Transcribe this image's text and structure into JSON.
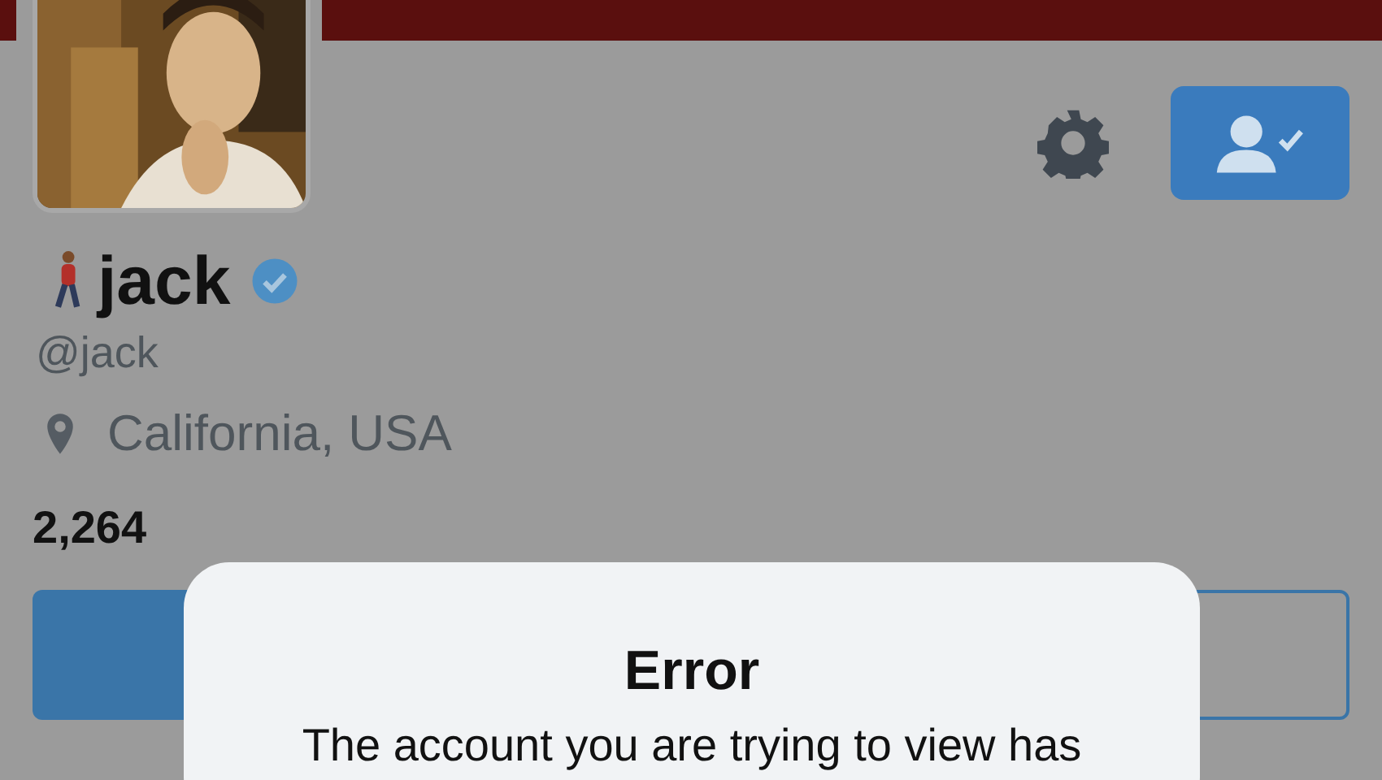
{
  "profile": {
    "name": "jack",
    "verified": true,
    "handle": "@jack",
    "location": "California, USA",
    "following_count": "2,264"
  },
  "dialog": {
    "title": "Error",
    "message": "The account you are trying to view has"
  }
}
